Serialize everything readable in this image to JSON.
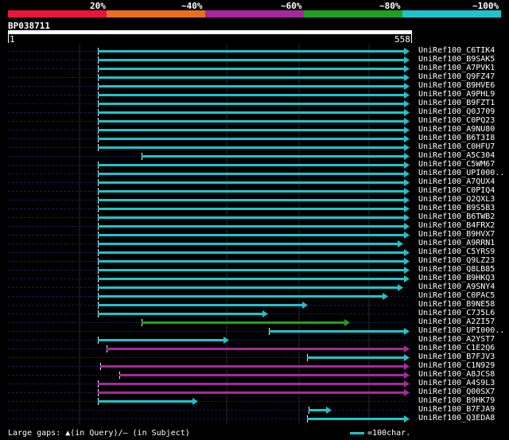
{
  "legend": {
    "labels": [
      "20%",
      "~40%",
      "~60%",
      "~80%",
      "~100%"
    ],
    "colors": [
      "#e8163a",
      "#e8701e",
      "#a8289c",
      "#1fa020",
      "#1ec4cc"
    ]
  },
  "query": {
    "id": "BP038711",
    "start": "1",
    "end": "558"
  },
  "colors": {
    "cyan": "#1ec4cc",
    "magenta": "#a8289c",
    "green": "#1fa020",
    "navy": "#0f1f5c",
    "grid": "#2a2a2a"
  },
  "hits": [
    {
      "name": "UniRef100_C6TIK4",
      "start": 123,
      "end": 515,
      "color": "cyan"
    },
    {
      "name": "UniRef100_B9SAK5",
      "start": 123,
      "end": 515,
      "color": "cyan"
    },
    {
      "name": "UniRef100_A7PVK1",
      "start": 123,
      "end": 515,
      "color": "cyan"
    },
    {
      "name": "UniRef100_Q9FZ47",
      "start": 123,
      "end": 515,
      "color": "cyan"
    },
    {
      "name": "UniRef100_B9HVE6",
      "start": 123,
      "end": 515,
      "color": "cyan"
    },
    {
      "name": "UniRef100_A9PHL9",
      "start": 123,
      "end": 515,
      "color": "cyan"
    },
    {
      "name": "UniRef100_B9FZT1",
      "start": 123,
      "end": 515,
      "color": "cyan"
    },
    {
      "name": "UniRef100_Q0J709",
      "start": 123,
      "end": 515,
      "color": "cyan"
    },
    {
      "name": "UniRef100_C0PQ23",
      "start": 123,
      "end": 515,
      "color": "cyan"
    },
    {
      "name": "UniRef100_A9NU80",
      "start": 123,
      "end": 515,
      "color": "cyan"
    },
    {
      "name": "UniRef100_B6T3I8",
      "start": 123,
      "end": 515,
      "color": "cyan"
    },
    {
      "name": "UniRef100_C0HFU7",
      "start": 123,
      "end": 515,
      "color": "cyan"
    },
    {
      "name": "UniRef100_A5C304",
      "start": 178,
      "end": 515,
      "color": "cyan"
    },
    {
      "name": "UniRef100_C5WM67",
      "start": 123,
      "end": 515,
      "color": "cyan"
    },
    {
      "name": "UniRef100_UPI000..",
      "start": 123,
      "end": 515,
      "color": "cyan"
    },
    {
      "name": "UniRef100_A7QUX4",
      "start": 123,
      "end": 515,
      "color": "cyan"
    },
    {
      "name": "UniRef100_C0PIQ4",
      "start": 123,
      "end": 515,
      "color": "cyan"
    },
    {
      "name": "UniRef100_Q2QXL3",
      "start": 123,
      "end": 515,
      "color": "cyan"
    },
    {
      "name": "UniRef100_B9S5B3",
      "start": 123,
      "end": 515,
      "color": "cyan"
    },
    {
      "name": "UniRef100_B6TWB2",
      "start": 123,
      "end": 515,
      "color": "cyan"
    },
    {
      "name": "UniRef100_B4FRX2",
      "start": 123,
      "end": 515,
      "color": "cyan"
    },
    {
      "name": "UniRef100_B9HVX7",
      "start": 123,
      "end": 515,
      "color": "cyan"
    },
    {
      "name": "UniRef100_A9RRN1",
      "start": 123,
      "end": 507,
      "color": "cyan"
    },
    {
      "name": "UniRef100_C5YRS9",
      "start": 123,
      "end": 515,
      "color": "cyan"
    },
    {
      "name": "UniRef100_Q9LZ23",
      "start": 123,
      "end": 515,
      "color": "cyan"
    },
    {
      "name": "UniRef100_Q8LB85",
      "start": 123,
      "end": 515,
      "color": "cyan"
    },
    {
      "name": "UniRef100_B9HKQ3",
      "start": 123,
      "end": 515,
      "color": "cyan"
    },
    {
      "name": "UniRef100_A9SNY4",
      "start": 123,
      "end": 507,
      "color": "cyan"
    },
    {
      "name": "UniRef100_C0PAC5",
      "start": 123,
      "end": 488,
      "color": "cyan"
    },
    {
      "name": "UniRef100_B9NE58",
      "start": 123,
      "end": 387,
      "color": "cyan"
    },
    {
      "name": "UniRef100_C7J5L6",
      "start": 123,
      "end": 337,
      "color": "cyan"
    },
    {
      "name": "UniRef100_A2ZI57",
      "start": 178,
      "end": 440,
      "color": "green"
    },
    {
      "name": "UniRef100_UPI000..",
      "start": 338,
      "end": 515,
      "color": "cyan"
    },
    {
      "name": "UniRef100_A2YST7",
      "start": 123,
      "end": 288,
      "color": "cyan"
    },
    {
      "name": "UniRef100_C1E2Q6",
      "start": 134,
      "end": 515,
      "color": "magenta"
    },
    {
      "name": "UniRef100_B7FJV3",
      "start": 386,
      "end": 515,
      "color": "cyan"
    },
    {
      "name": "UniRef100_C1N929",
      "start": 126,
      "end": 515,
      "color": "magenta"
    },
    {
      "name": "UniRef100_A8JCS8",
      "start": 150,
      "end": 515,
      "color": "magenta"
    },
    {
      "name": "UniRef100_A4S9L3",
      "start": 123,
      "end": 515,
      "color": "magenta"
    },
    {
      "name": "UniRef100_Q00SX7",
      "start": 123,
      "end": 515,
      "color": "magenta"
    },
    {
      "name": "UniRef100_B9HK79",
      "start": 123,
      "end": 249,
      "color": "cyan"
    },
    {
      "name": "UniRef100_B7FJA9",
      "start": 388,
      "end": 417,
      "color": "cyan"
    },
    {
      "name": "UniRef100_Q3EDA8",
      "start": 386,
      "end": 515,
      "color": "cyan"
    }
  ],
  "footer": {
    "left": "Large gaps: ▲(in Query)/– (in Subject)",
    "right": "=100char."
  }
}
